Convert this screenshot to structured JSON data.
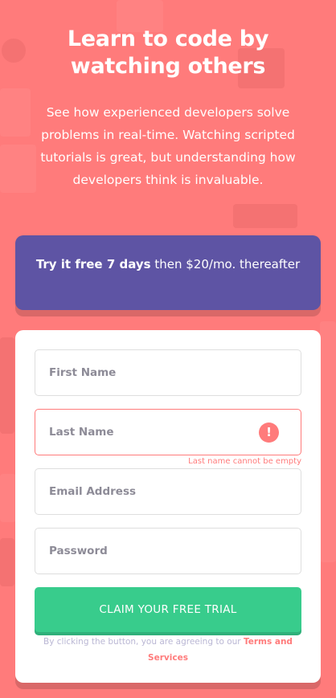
{
  "hero": {
    "title": "Learn to code by watching others",
    "subtitle": "See how experienced developers solve problems in real-time. Watching scripted tutorials is great, but understanding how developers think is invaluable."
  },
  "promo": {
    "bold_text": "Try it free 7 days",
    "rest_text": " then $20/mo. thereafter"
  },
  "form": {
    "first_name": {
      "placeholder": "First Name",
      "value": ""
    },
    "last_name": {
      "placeholder": "Last Name",
      "value": "",
      "error": "Last name cannot be empty",
      "error_icon": "!"
    },
    "email": {
      "placeholder": "Email Address",
      "value": ""
    },
    "password": {
      "placeholder": "Password",
      "value": ""
    },
    "submit_label": "CLAIM YOUR FREE TRIAL",
    "terms_prefix": "By clicking the button, you are agreeing to our ",
    "terms_link": "Terms and Services"
  },
  "colors": {
    "background": "#ff7b7b",
    "promo": "#5e54a4",
    "button": "#38cc8c",
    "error": "#ff7b7b"
  }
}
